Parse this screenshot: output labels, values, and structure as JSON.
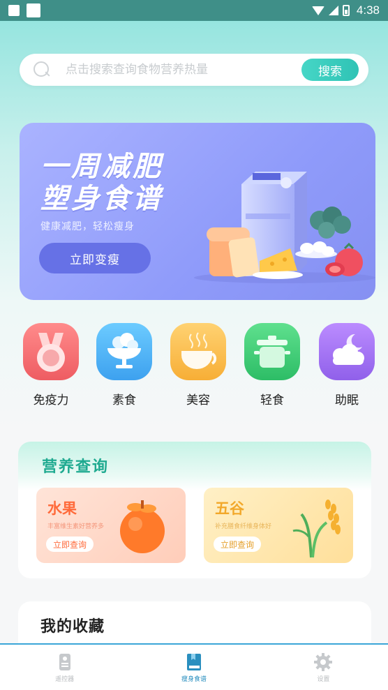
{
  "status_bar": {
    "time": "4:38"
  },
  "search": {
    "placeholder": "点击搜索查询食物营养热量",
    "button_label": "搜索"
  },
  "banner": {
    "title_line1": "一周减肥",
    "title_line2": "塑身食谱",
    "subtitle": "健康减肥，轻松瘦身",
    "button_label": "立即变瘦"
  },
  "categories": [
    {
      "label": "免疫力",
      "icon": "medal-icon",
      "color": "#f26f6f"
    },
    {
      "label": "素食",
      "icon": "ice-cream-icon",
      "color": "#4fb3f5"
    },
    {
      "label": "美容",
      "icon": "coffee-cup-icon",
      "color": "#f8b743"
    },
    {
      "label": "轻食",
      "icon": "pot-icon",
      "color": "#3fcf7c"
    },
    {
      "label": "助眠",
      "icon": "moon-cloud-icon",
      "color": "#a277ee"
    }
  ],
  "nutrition": {
    "title": "营养查询",
    "tiles": [
      {
        "title": "水果",
        "subtitle": "丰富维生素好营养多",
        "button_label": "立即查询",
        "color": "#ff6a3a"
      },
      {
        "title": "五谷",
        "subtitle": "补充膳食纤维身体好",
        "button_label": "立即查询",
        "color": "#f2a82a"
      }
    ]
  },
  "favorites": {
    "title": "我的收藏"
  },
  "bottom_nav": {
    "items": [
      {
        "label": "遥控器",
        "icon": "remote-icon",
        "active": false
      },
      {
        "label": "瘦身食谱",
        "icon": "book-icon",
        "active": true
      },
      {
        "label": "设置",
        "icon": "gear-icon",
        "active": false
      }
    ]
  },
  "colors": {
    "accent": "#2fc3b5",
    "banner": "#8f9bfa",
    "nav_active": "#2a8fbf"
  }
}
